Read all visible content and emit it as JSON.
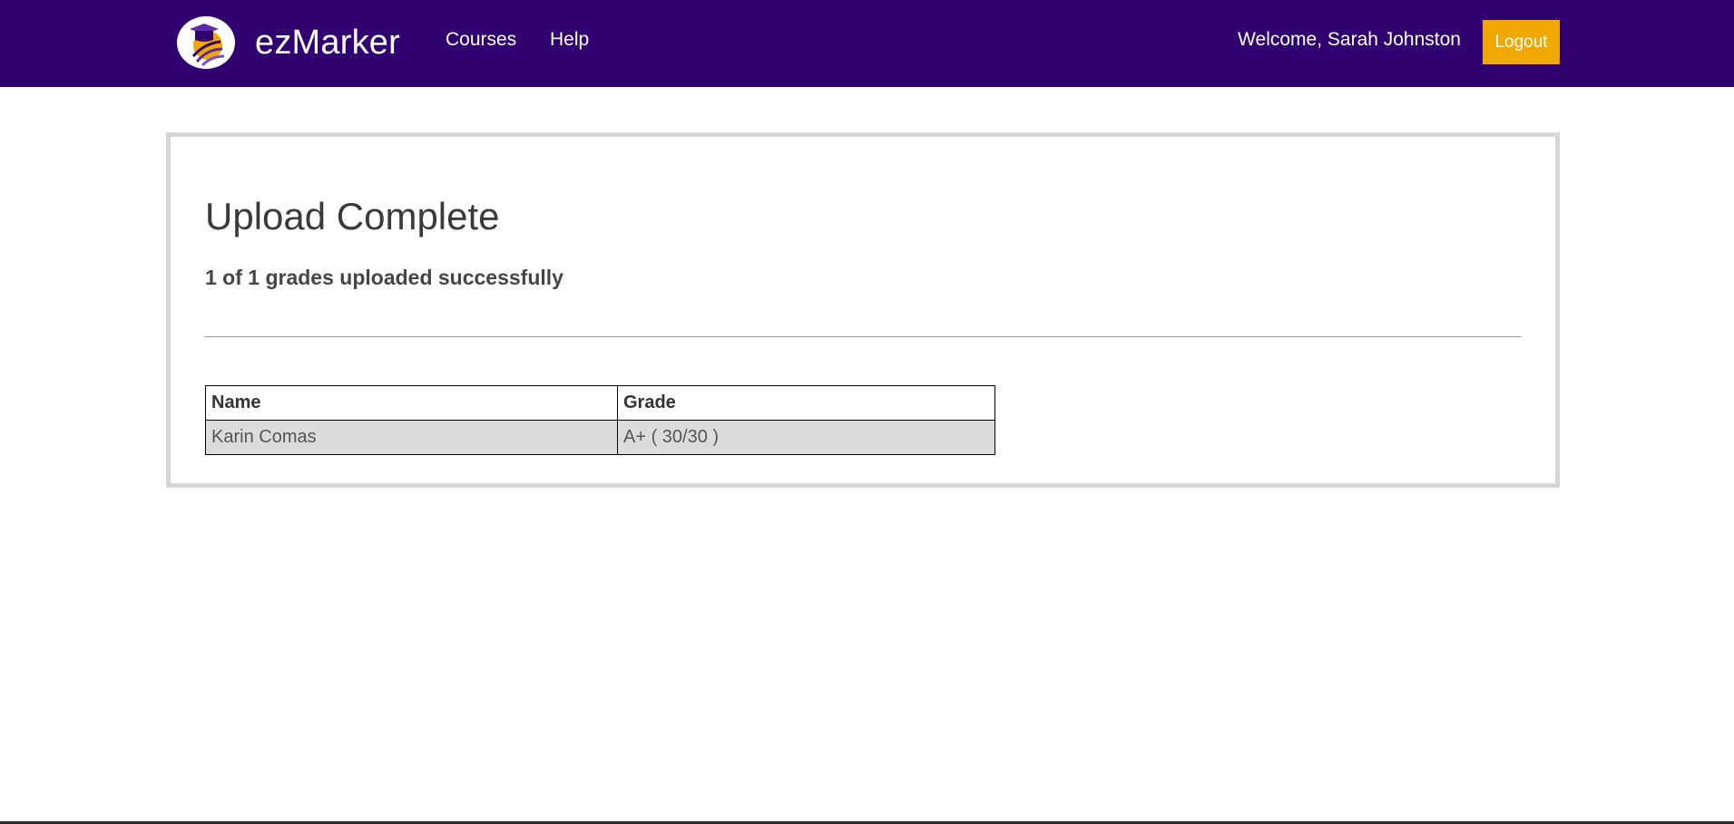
{
  "header": {
    "brand": "ezMarker",
    "nav": [
      {
        "label": "Courses"
      },
      {
        "label": "Help"
      }
    ],
    "welcome": "Welcome, Sarah Johnston",
    "logout_label": "Logout"
  },
  "card": {
    "title": "Upload Complete",
    "subtitle": "1 of 1 grades uploaded successfully",
    "table": {
      "columns": [
        "Name",
        "Grade"
      ],
      "rows": [
        [
          "Karin Comas",
          "A+ ( 30/30 )"
        ]
      ]
    }
  },
  "colors": {
    "navbar": "#310070",
    "logout": "#f0a800",
    "card_border": "#d4d6d8"
  }
}
